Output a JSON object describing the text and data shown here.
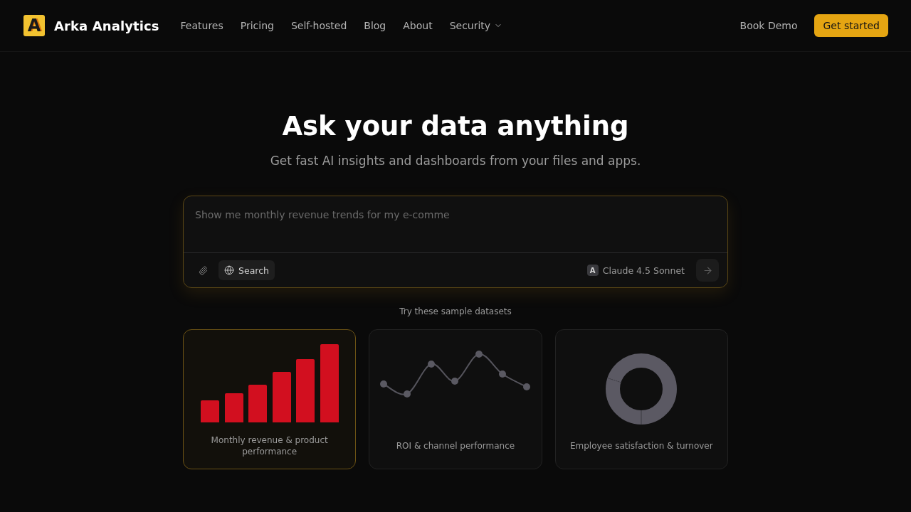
{
  "nav": {
    "logo_letter": "A",
    "brand": "Arka Analytics",
    "links": [
      {
        "label": "Features",
        "kind": "link"
      },
      {
        "label": "Pricing",
        "kind": "link"
      },
      {
        "label": "Self-hosted",
        "kind": "link"
      },
      {
        "label": "Blog",
        "kind": "link"
      },
      {
        "label": "About",
        "kind": "link"
      },
      {
        "label": "Security",
        "kind": "dropdown"
      }
    ],
    "book_demo": "Book Demo",
    "cta": "Get started"
  },
  "hero": {
    "title": "Ask your data anything",
    "subtitle": "Get fast AI insights and dashboards from your files and apps."
  },
  "prompt": {
    "placeholder": "Show me monthly revenue trends for my e-comme",
    "search_label": "Search",
    "model": {
      "badge": "A",
      "name": "Claude 4.5 Sonnet"
    }
  },
  "samples": {
    "heading": "Try these sample datasets",
    "cards": [
      {
        "kind": "bar",
        "label": "Monthly revenue & product performance",
        "selected": true
      },
      {
        "kind": "line",
        "label": "ROI & channel performance",
        "selected": false
      },
      {
        "kind": "donut",
        "label": "Employee satisfaction & turnover",
        "selected": false
      }
    ]
  }
}
